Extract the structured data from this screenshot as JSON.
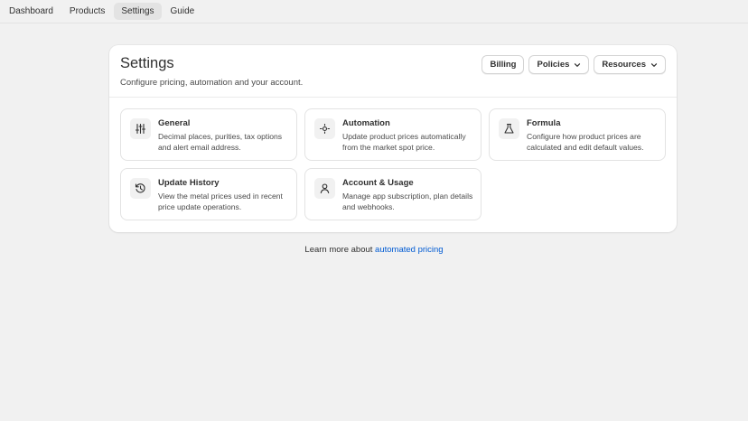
{
  "nav": {
    "tabs": [
      {
        "label": "Dashboard"
      },
      {
        "label": "Products"
      },
      {
        "label": "Settings",
        "active": true
      },
      {
        "label": "Guide"
      }
    ]
  },
  "header": {
    "title": "Settings",
    "subtitle": "Configure pricing, automation and your account.",
    "buttons": {
      "billing": "Billing",
      "policies": "Policies",
      "resources": "Resources"
    }
  },
  "tiles": [
    {
      "title": "General",
      "desc": "Decimal places, purities, tax options and alert email address.",
      "icon": "sliders-icon"
    },
    {
      "title": "Automation",
      "desc": "Update product prices automatically from the market spot price.",
      "icon": "automation-icon"
    },
    {
      "title": "Formula",
      "desc": "Configure how product prices are calculated and edit default values.",
      "icon": "flask-icon"
    },
    {
      "title": "Update History",
      "desc": "View the metal prices used in recent price update operations.",
      "icon": "history-icon"
    },
    {
      "title": "Account & Usage",
      "desc": "Manage app subscription, plan details and webhooks.",
      "icon": "person-icon"
    }
  ],
  "footer": {
    "text": "Learn more about ",
    "link": "automated pricing"
  },
  "colors": {
    "background": "#f1f1f1",
    "card": "#ffffff",
    "link": "#005bd3",
    "active_tab": "#e3e3e3"
  }
}
